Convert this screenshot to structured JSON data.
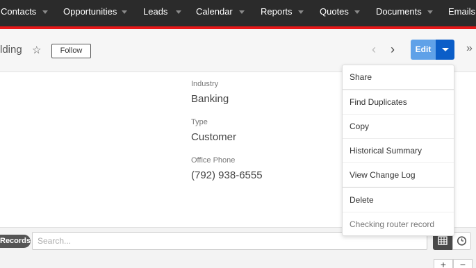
{
  "nav": {
    "items": [
      {
        "label": "Contacts"
      },
      {
        "label": "Opportunities"
      },
      {
        "label": "Leads"
      },
      {
        "label": "Calendar"
      },
      {
        "label": "Reports"
      },
      {
        "label": "Quotes"
      },
      {
        "label": "Documents"
      },
      {
        "label": "Emails"
      }
    ]
  },
  "header": {
    "title": "lding",
    "follow_label": "Follow",
    "edit_label": "Edit"
  },
  "record": {
    "fields": [
      {
        "label": "Industry",
        "value": "Banking"
      },
      {
        "label": "Type",
        "value": "Customer"
      },
      {
        "label": "Office Phone",
        "value": "(792) 938-6555"
      }
    ]
  },
  "actions_menu": {
    "items": [
      {
        "label": "Share"
      },
      {
        "label": "Find Duplicates"
      },
      {
        "label": "Copy"
      },
      {
        "label": "Historical Summary"
      },
      {
        "label": "View Change Log"
      },
      {
        "label": "Delete"
      },
      {
        "label": "Checking router record"
      }
    ]
  },
  "subpanel": {
    "records_label": "Records",
    "search_placeholder": "Search...",
    "plus": "+",
    "minus": "−"
  },
  "icons": {
    "star": "star-icon",
    "prev": "chevron-left-icon",
    "next": "chevron-right-icon",
    "caret": "caret-down-icon",
    "collapse": "double-chevron-right-icon",
    "grid": "grid-icon",
    "clock": "clock-icon"
  },
  "colors": {
    "nav_bg": "#2b2b2b",
    "nav_accent": "#e61718",
    "edit_button": "#5fa1e8",
    "edit_caret": "#0b5ec8"
  }
}
